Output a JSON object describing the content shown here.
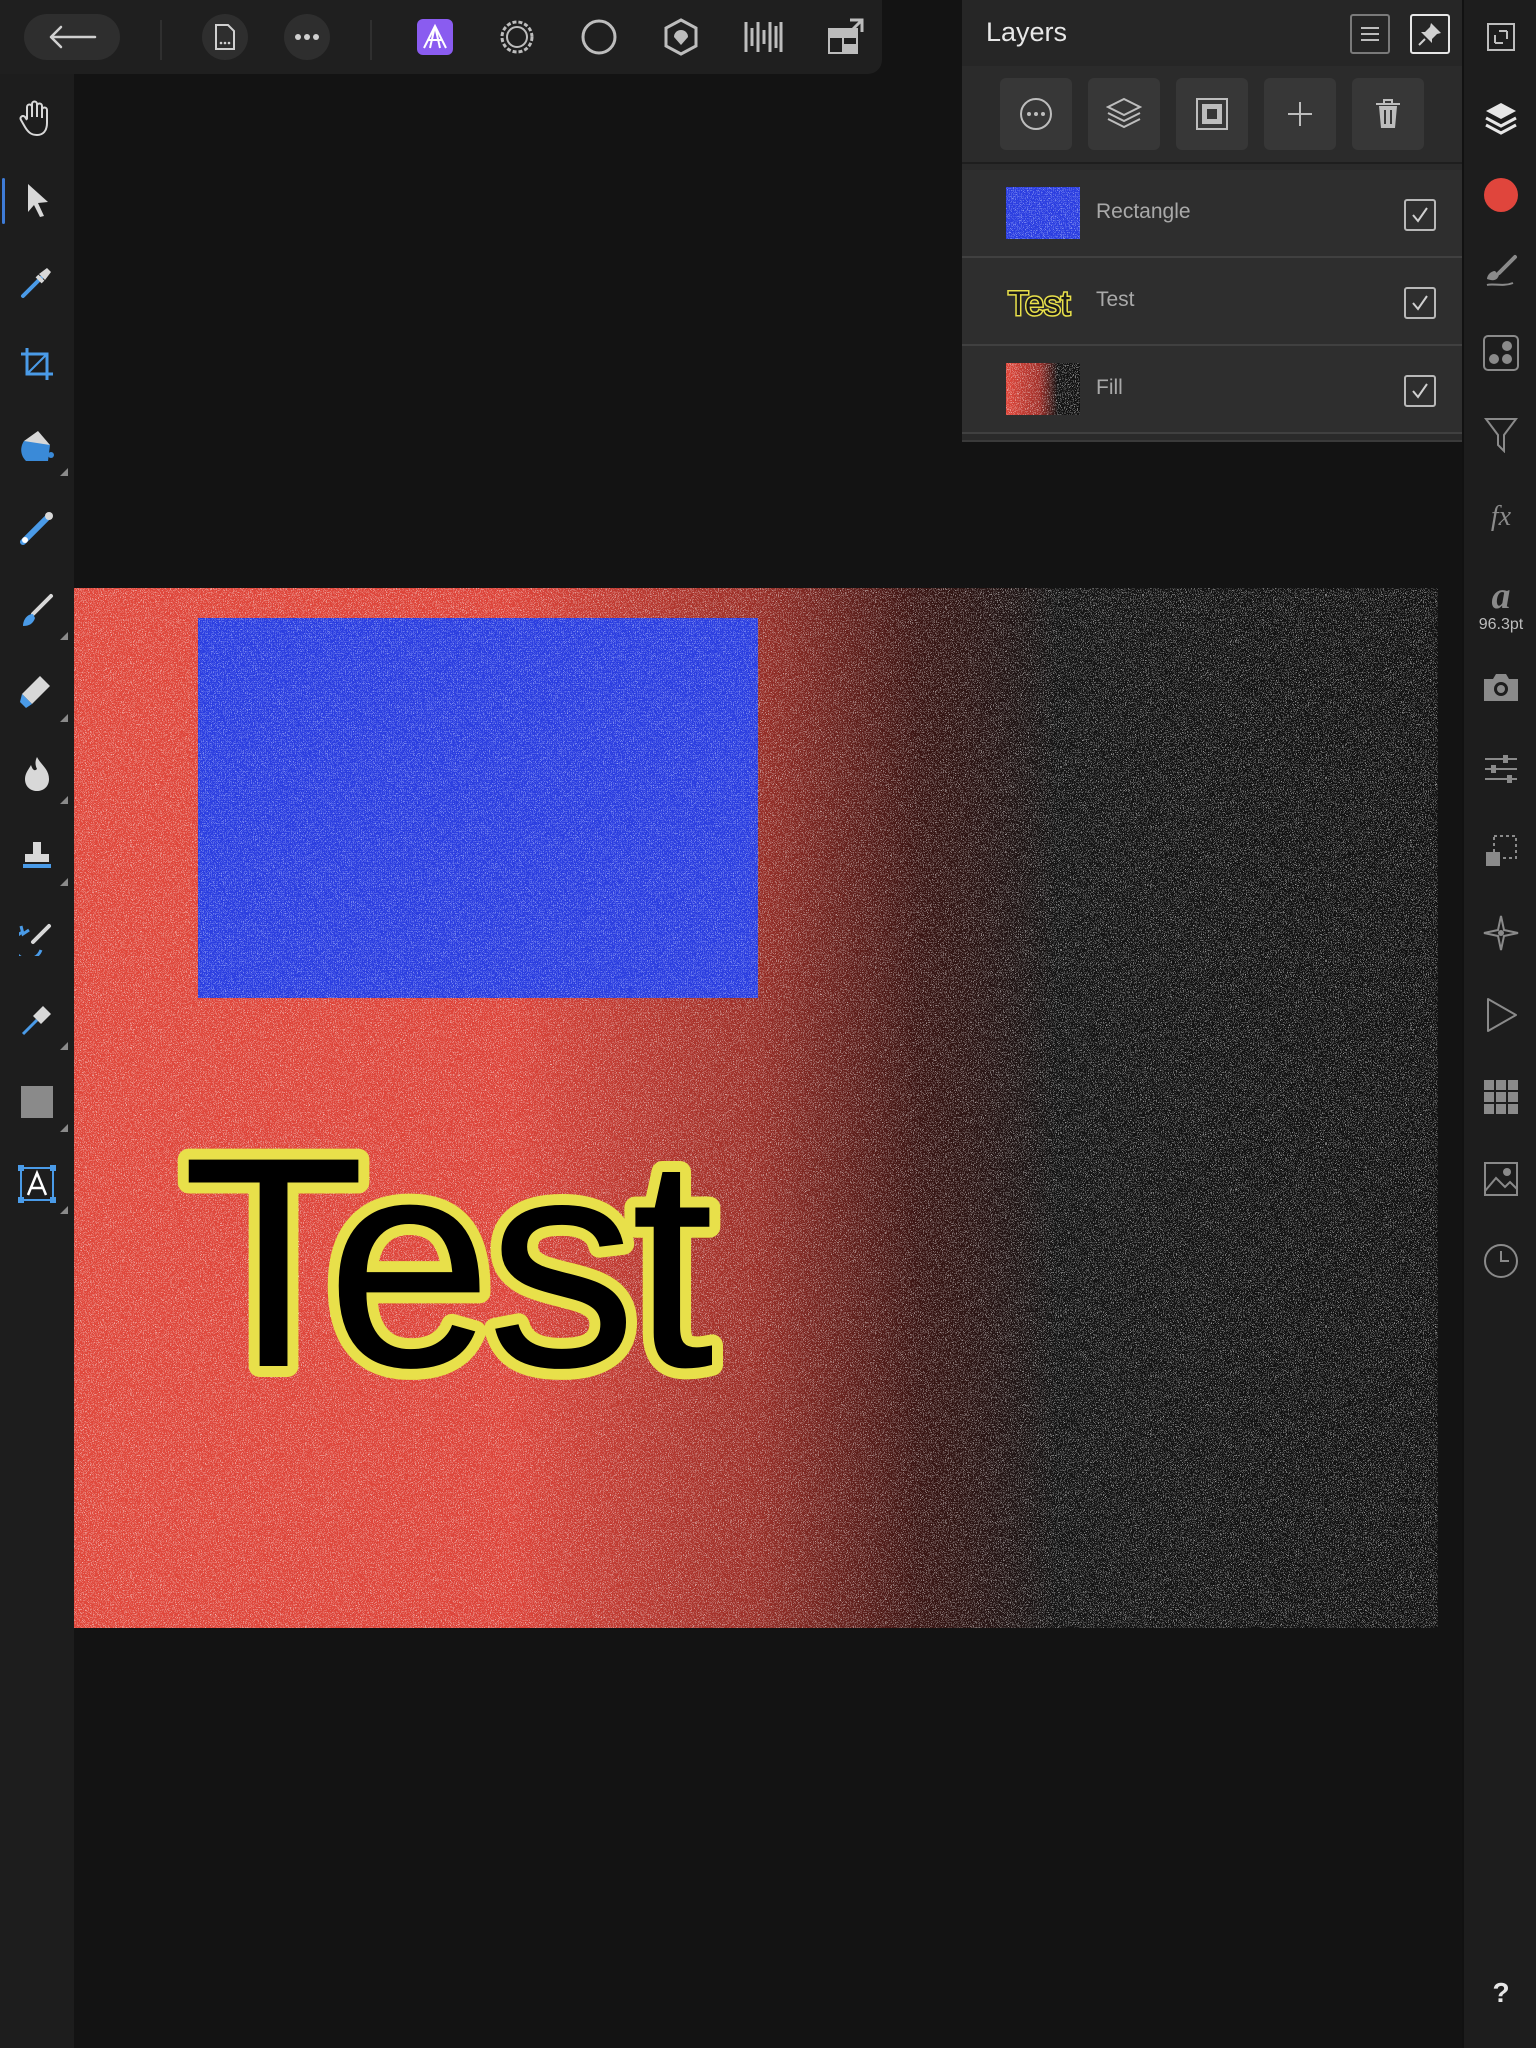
{
  "top_toolbar": {
    "back_icon": "arrow-left-icon",
    "document_icon": "document-icon",
    "more_icon": "more-icon",
    "personas": [
      "photo-persona-icon",
      "liquify-persona-icon",
      "develop-persona-icon",
      "tone-mapping-persona-icon",
      "export-persona-icon"
    ],
    "workspace_icon": "workspace-icon",
    "active_persona_color": "#8a5cf0"
  },
  "tools": [
    "view-hand-icon",
    "move-arrow-icon",
    "color-picker-icon",
    "crop-icon",
    "flood-fill-icon",
    "gradient-icon",
    "paint-brush-icon",
    "erase-brush-icon",
    "burn-brush-icon",
    "clone-stamp-icon",
    "undo-brush-icon",
    "pen-icon",
    "rectangle-icon",
    "artistic-text-icon"
  ],
  "studio": {
    "items": [
      "fit-view-icon",
      "layers-icon",
      "color-icon",
      "brushes-icon",
      "channels-icon",
      "filter-icon",
      "fx-icon",
      "character-icon",
      "camera-icon",
      "adjustments-icon",
      "transform-icon",
      "navigator-icon",
      "macro-icon",
      "swatches-icon",
      "stock-icon",
      "history-icon",
      "help-icon"
    ],
    "fx_label": "fx",
    "character_glyph": "a",
    "font_size": "96.3pt",
    "help_label": "?",
    "current_color": "#e0453c"
  },
  "layers_panel": {
    "title": "Layers",
    "header_buttons": [
      "panel-menu-icon",
      "pin-icon"
    ],
    "action_buttons": [
      "layer-options-icon",
      "layer-stack-icon",
      "mask-icon",
      "add-layer-icon",
      "delete-layer-icon"
    ],
    "layers": [
      {
        "name": "Rectangle",
        "thumb": "rectangle",
        "visible": true
      },
      {
        "name": "Test",
        "thumb": "text",
        "visible": true
      },
      {
        "name": "Fill",
        "thumb": "fill",
        "visible": true
      }
    ]
  },
  "canvas": {
    "text": "Test",
    "text_fill": "#000000",
    "text_outline": "#e8e04a",
    "rect_color": "#2b3ee0",
    "fill_start": "#e0483c",
    "fill_end": "#111111"
  }
}
